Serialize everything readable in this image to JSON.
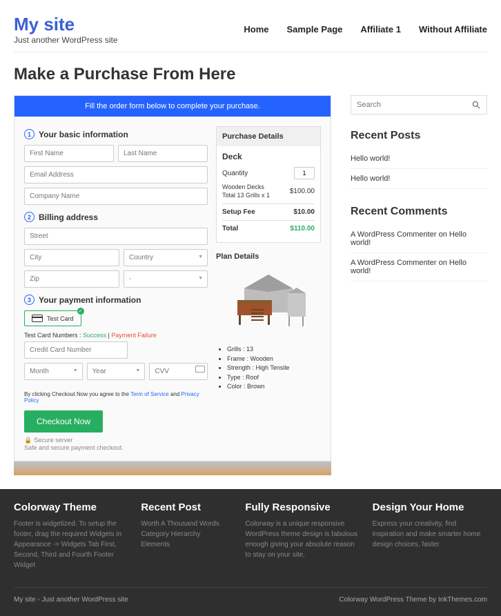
{
  "header": {
    "site": "My site",
    "tagline": "Just another WordPress site",
    "nav": [
      "Home",
      "Sample Page",
      "Affiliate 1",
      "Without Affiliate"
    ]
  },
  "page": {
    "title": "Make a Purchase From Here",
    "bluebar": "Fill the order form below to complete your purchase."
  },
  "form": {
    "step1": {
      "num": "1",
      "title": "Your basic information",
      "first": "First Name",
      "last": "Last Name",
      "email": "Email Address",
      "company": "Company Name"
    },
    "step2": {
      "num": "2",
      "title": "Billing address",
      "street": "Street",
      "city": "City",
      "country": "Country",
      "zip": "Zip",
      "dash": "-"
    },
    "step3": {
      "num": "3",
      "title": "Your payment information",
      "card_label": "Test  Card",
      "numbers_label": "Test Card Numbers : ",
      "success": "Success",
      "sep": " | ",
      "failure": "Payment Failure",
      "cc": "Credit Card Number",
      "month": "Month",
      "year": "Year",
      "cvv": "CVV",
      "terms_pre": "By clicking Checkout Now you agree to the ",
      "tos": "Term of Service",
      "and": " and ",
      "pp": "Privacy Policy",
      "checkout": "Checkout Now",
      "secure": "Secure server",
      "safe": "Safe and secure payment checkout."
    }
  },
  "summary": {
    "head": "Purchase Details",
    "deck": "Deck",
    "qty_label": "Quantity",
    "qty": "1",
    "item": "Wooden Decks Total 13 Grills x 1",
    "item_price": "$100.00",
    "setup": "Setup Fee",
    "setup_price": "$10.00",
    "total": "Total",
    "total_price": "$110.00",
    "plan_h": "Plan Details",
    "plan": [
      "Grills : 13",
      "Frame : Wooden",
      "Strength : High Tensile",
      "Type : Roof",
      "Color : Brown"
    ]
  },
  "sidebar": {
    "search": "Search",
    "posts_h": "Recent Posts",
    "posts": [
      "Hello world!",
      "Hello world!"
    ],
    "comments_h": "Recent Comments",
    "comments": [
      {
        "a": "A WordPress Commenter",
        "on": " on ",
        "p": "Hello world!"
      },
      {
        "a": "A WordPress Commenter",
        "on": " on ",
        "p": "Hello world!"
      }
    ]
  },
  "footer": {
    "cols": [
      {
        "h": "Colorway Theme",
        "t": "Footer is widgetized. To setup the footer, drag the required Widgets in Appearance -> Widgets Tab First, Second, Third and Fourth Footer Widget"
      },
      {
        "h": "Recent Post",
        "t": "Worth A Thousand Words\nCategory Hierarchy\nElements"
      },
      {
        "h": "Fully Responsive",
        "t": "Colorway is a unique responsive WordPress theme design is fabulous enough giving your absolute reason to stay on your site."
      },
      {
        "h": "Design Your Home",
        "t": "Express your creativity, find inspiration and make smarter home design choices, faster."
      }
    ],
    "left": "My site - Just another WordPress site",
    "right": "Colorway WordPress Theme by InkThemes.com"
  }
}
